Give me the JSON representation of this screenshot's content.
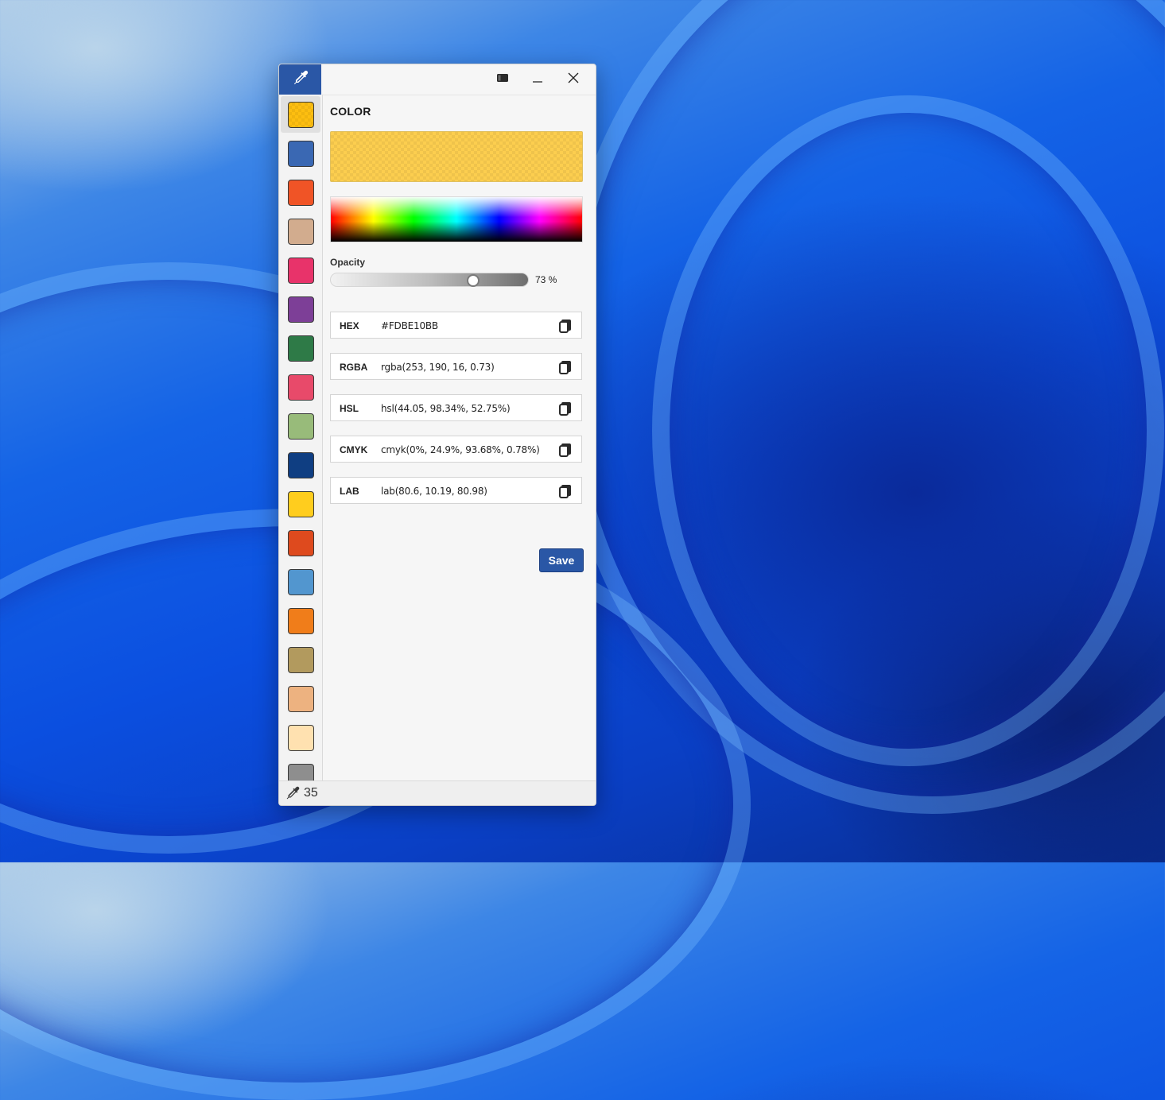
{
  "window": {
    "controls": {
      "compact_icon": "compact-mode-icon",
      "minimize_icon": "minimize-icon",
      "close_icon": "close-icon"
    }
  },
  "sidebar": {
    "swatches": [
      {
        "color": "#FDBE10",
        "selected": true
      },
      {
        "color": "#3A68B3"
      },
      {
        "color": "#F05426"
      },
      {
        "color": "#D2AC8E"
      },
      {
        "color": "#E8336A"
      },
      {
        "color": "#7D3F97"
      },
      {
        "color": "#2E7A47"
      },
      {
        "color": "#E84A6A"
      },
      {
        "color": "#98BB7A"
      },
      {
        "color": "#0F3E82"
      },
      {
        "color": "#FFCD1E"
      },
      {
        "color": "#DE4A1E"
      },
      {
        "color": "#5296CF"
      },
      {
        "color": "#F07D1A"
      },
      {
        "color": "#B29A5E"
      },
      {
        "color": "#EDB280"
      },
      {
        "color": "#FFE1B0"
      },
      {
        "color": "#8E8E8E"
      }
    ]
  },
  "main": {
    "section_title": "COLOR",
    "selected_color": "#FDBE10",
    "opacity": {
      "label": "Opacity",
      "value_text": "73 %",
      "fraction": 0.73
    },
    "formats": [
      {
        "label": "HEX",
        "value": "#FDBE10BB"
      },
      {
        "label": "RGBA",
        "value": "rgba(253, 190, 16, 0.73)"
      },
      {
        "label": "HSL",
        "value": "hsl(44.05, 98.34%, 52.75%)"
      },
      {
        "label": "CMYK",
        "value": "cmyk(0%, 24.9%, 93.68%, 0.78%)"
      },
      {
        "label": "LAB",
        "value": "lab(80.6, 10.19, 80.98)"
      }
    ],
    "save_label": "Save"
  },
  "status": {
    "count": "35"
  },
  "colors": {
    "accent": "#2A57A6"
  }
}
